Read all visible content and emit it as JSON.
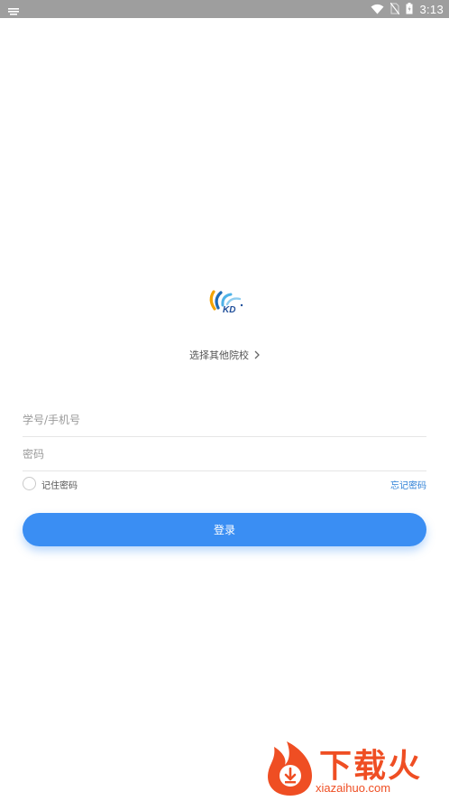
{
  "status_bar": {
    "time": "3:13",
    "icons": [
      "notification-icon",
      "wifi-icon",
      "no-sim-icon",
      "battery-icon"
    ]
  },
  "logo": {
    "text": "KD",
    "colors": [
      "#f2a300",
      "#1f6bb5",
      "#4fb3e8"
    ]
  },
  "school_select": {
    "label": "选择其他院校"
  },
  "login_form": {
    "username_placeholder": "学号/手机号",
    "password_placeholder": "密码",
    "remember_label": "记住密码",
    "forgot_label": "忘记密码",
    "submit_label": "登录"
  },
  "watermark": {
    "text": "下载火",
    "url": "xiazaihuo.com"
  },
  "colors": {
    "accent": "#3a8ef3",
    "link": "#2c7fd6",
    "status_bar": "#9e9e9e",
    "watermark": "#ef4e23"
  }
}
